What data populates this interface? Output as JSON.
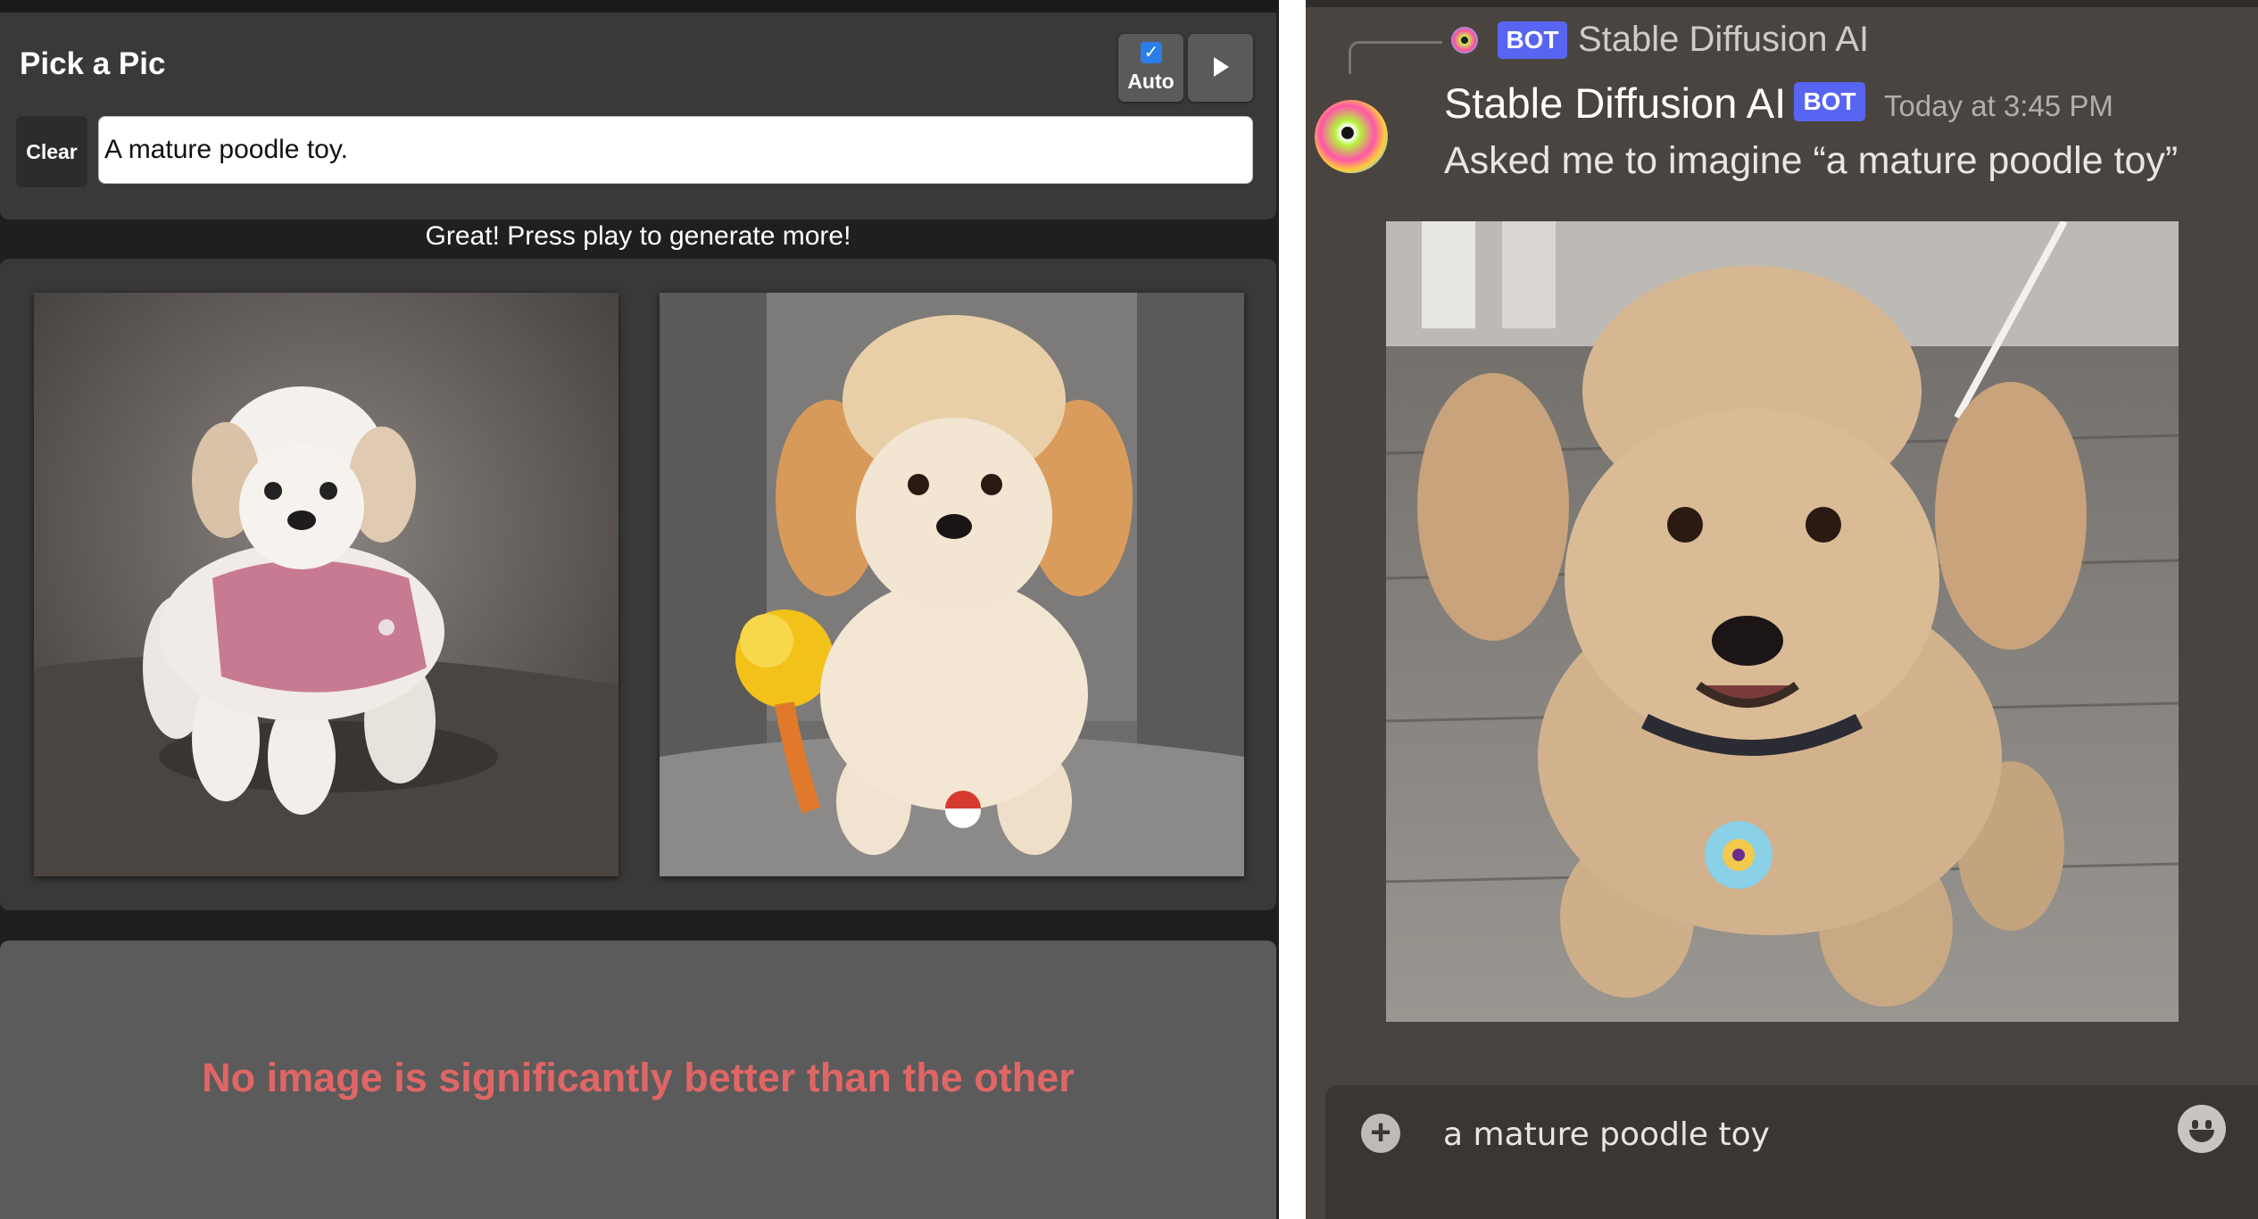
{
  "picker": {
    "title": "Pick a Pic",
    "auto_label": "Auto",
    "auto_checked": true,
    "clear_label": "Clear",
    "prompt_value": "A mature poodle toy.",
    "status_message": "Great! Press play to generate more!",
    "verdict_message": "No image is significantly better than the other",
    "icons": {
      "checkbox": "checkbox-checked-icon",
      "play": "play-icon"
    },
    "colors": {
      "verdict_text": "#e06666",
      "checkbox_accent": "#2b7de9"
    }
  },
  "discord": {
    "reply_bot_badge": "BOT",
    "reply_author": "Stable Diffusion AI",
    "author": "Stable Diffusion AI",
    "bot_badge": "BOT",
    "timestamp": "Today at 3:45 PM",
    "message": "Asked me to imagine “a mature poodle toy”",
    "composer_value": "a mature poodle toy",
    "icons": {
      "add": "plus-circle-icon",
      "emoji": "smiley-emoji-icon"
    },
    "colors": {
      "bot_badge": "#5865f2"
    }
  }
}
